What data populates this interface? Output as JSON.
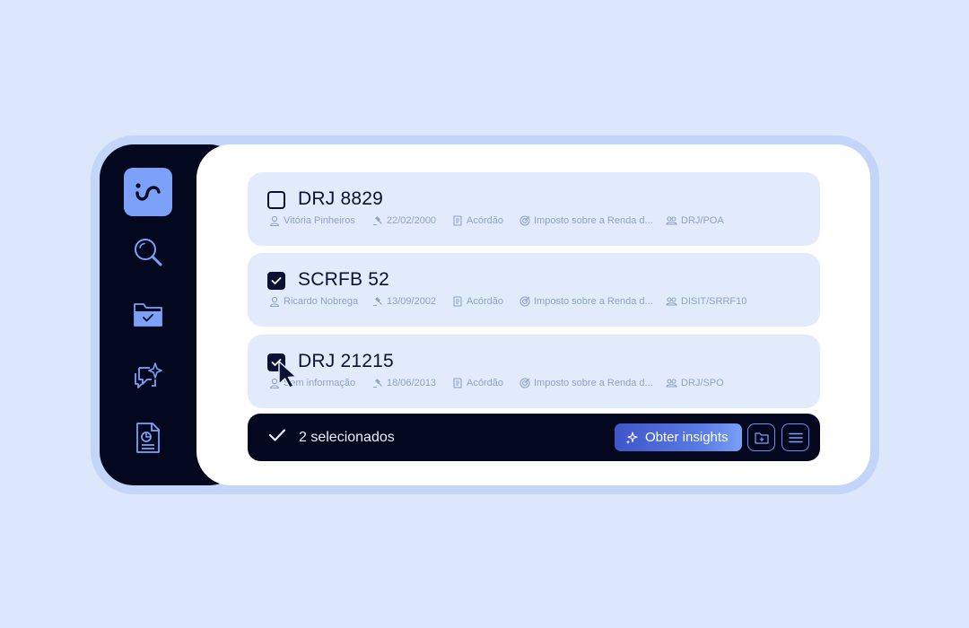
{
  "colors": {
    "background": "#dce7fb",
    "sidebar": "#03081f",
    "accent": "#7ba2f8",
    "card": "#e2ebfb",
    "meta_text": "#8ea2c6"
  },
  "sidebar": {
    "items": [
      {
        "name": "logo",
        "icon": "logo-icon"
      },
      {
        "name": "search",
        "icon": "search-icon"
      },
      {
        "name": "folder",
        "icon": "folder-check-icon"
      },
      {
        "name": "chat",
        "icon": "chat-sparkle-icon"
      },
      {
        "name": "report",
        "icon": "report-icon"
      }
    ]
  },
  "cards": [
    {
      "title": "DRJ 8829",
      "checked": false,
      "author": "Vitória Pinheiros",
      "date": "22/02/2000",
      "type": "Acórdão",
      "subject": "Imposto sobre a Renda d...",
      "unit": "DRJ/POA"
    },
    {
      "title": "SCRFB 52",
      "checked": true,
      "author": "Ricardo Nobrega",
      "date": "13/09/2002",
      "type": "Acórdão",
      "subject": "Imposto sobre a Renda d...",
      "unit": "DISIT/SRRF10"
    },
    {
      "title": "DRJ 21215",
      "checked": true,
      "author": "Sem informação",
      "date": "18/06/2013",
      "type": "Acórdão",
      "subject": "Imposto sobre a Renda d...",
      "unit": "DRJ/SPO"
    }
  ],
  "action_bar": {
    "selected_label": "2 selecionados",
    "insights_label": "Obter insights"
  }
}
